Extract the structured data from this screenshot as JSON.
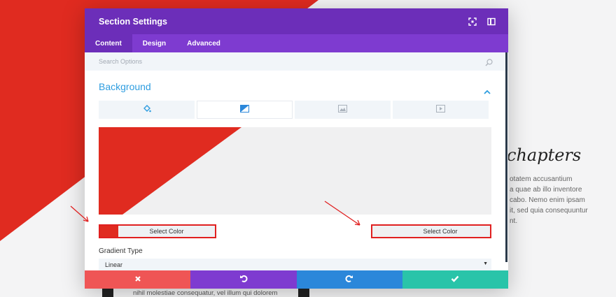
{
  "background_page": {
    "heading": "chapters",
    "paragraph_lines": [
      "otatem accusantium",
      "a quae ab illo inventore",
      "cabo. Nemo enim ipsam",
      "it, sed quia consequuntur",
      "nt."
    ],
    "bottom_text": "nihil molestiae consequatur, vel illum qui dolorem"
  },
  "modal": {
    "title": "Section Settings",
    "header_icons": [
      "fullscreen-icon",
      "sidebar-toggle-icon"
    ],
    "tabs": [
      {
        "label": "Content",
        "active": true
      },
      {
        "label": "Design",
        "active": false
      },
      {
        "label": "Advanced",
        "active": false
      }
    ],
    "search": {
      "placeholder": "Search Options",
      "value": ""
    },
    "section": {
      "title": "Background",
      "expanded": true,
      "bg_tabs": [
        {
          "icon": "paint-bucket-icon",
          "active": false
        },
        {
          "icon": "gradient-icon",
          "active": true
        },
        {
          "icon": "image-icon",
          "active": false
        },
        {
          "icon": "video-icon",
          "active": false
        }
      ],
      "gradient_start": {
        "label": "Select Color",
        "color": "#e02b20"
      },
      "gradient_end": {
        "label": "Select Color",
        "color": "#f0f0f1"
      },
      "gradient_type": {
        "label": "Gradient Type",
        "value": "Linear"
      }
    },
    "footer_buttons": [
      {
        "name": "discard",
        "icon": "close-icon",
        "color": "#ef5555"
      },
      {
        "name": "undo",
        "icon": "undo-icon",
        "color": "#7e3bd0"
      },
      {
        "name": "redo",
        "icon": "redo-icon",
        "color": "#2b87da"
      },
      {
        "name": "save",
        "icon": "check-icon",
        "color": "#29c4a9"
      }
    ]
  },
  "colors": {
    "header": "#6c2eb9",
    "tabs_bar": "#7e3bd0",
    "accent_blue": "#2e9de0",
    "annotation_red": "#e02020"
  }
}
